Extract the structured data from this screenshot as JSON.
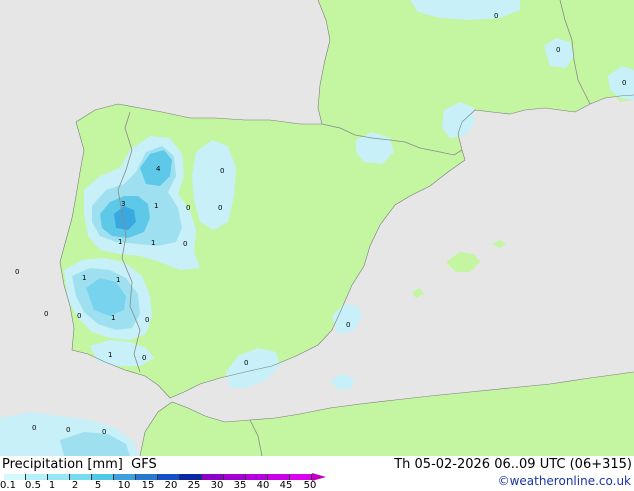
{
  "title_left": "Precipitation [mm]  GFS",
  "title_right": "Th 05-02-2026 06..09 UTC (06+315)",
  "credit": "©weatheronline.co.uk",
  "legend": {
    "ticks": [
      "0.1",
      "0.5",
      "1",
      "2",
      "5",
      "10",
      "15",
      "20",
      "25",
      "30",
      "35",
      "40",
      "45",
      "50"
    ],
    "colors": [
      "#d2faff",
      "#b4f0fa",
      "#96e6f5",
      "#78dcf0",
      "#50c8e6",
      "#3ca0dc",
      "#2878d2",
      "#1450c8",
      "#0a28a0",
      "#8c00c8",
      "#a000d2",
      "#b400dc",
      "#c800e6",
      "#dc00f0"
    ]
  },
  "map_colors": {
    "sea": "#e6e6e6",
    "land_dry": "#c4f5a0",
    "precip_light": "#c8f0f8",
    "precip_medium": "#9ee0f0",
    "precip_heavy": "#5ec8e8",
    "precip_core": "#3aa8e0",
    "border": "#8a8a8a"
  },
  "value_labels": [
    {
      "text": "0",
      "name": "label-biscay-ne"
    },
    {
      "text": "0",
      "name": "label-gascony"
    },
    {
      "text": "0",
      "name": "label-provence"
    },
    {
      "text": "4",
      "name": "label-leon"
    },
    {
      "text": "0",
      "name": "label-burgos"
    },
    {
      "text": "3",
      "name": "label-salamanca"
    },
    {
      "text": "1",
      "name": "label-avila"
    },
    {
      "text": "0",
      "name": "label-madrid-w"
    },
    {
      "text": "0",
      "name": "label-madrid"
    },
    {
      "text": "1",
      "name": "label-caceres"
    },
    {
      "text": "1",
      "name": "label-toledo"
    },
    {
      "text": "0",
      "name": "label-ciudad-real"
    },
    {
      "text": "0",
      "name": "label-atlantic-w"
    },
    {
      "text": "1",
      "name": "label-alentejo-w"
    },
    {
      "text": "1",
      "name": "label-badajoz"
    },
    {
      "text": "0",
      "name": "label-atlantic-sw"
    },
    {
      "text": "0",
      "name": "label-portugal-coast"
    },
    {
      "text": "1",
      "name": "label-alentejo-s"
    },
    {
      "text": "0",
      "name": "label-cordoba"
    },
    {
      "text": "1",
      "name": "label-algarve"
    },
    {
      "text": "0",
      "name": "label-seville"
    },
    {
      "text": "0",
      "name": "label-valencia"
    },
    {
      "text": "0",
      "name": "label-granada"
    },
    {
      "text": "0",
      "name": "label-morocco-w"
    },
    {
      "text": "0",
      "name": "label-morocco-c"
    },
    {
      "text": "0",
      "name": "label-morocco-e"
    }
  ]
}
